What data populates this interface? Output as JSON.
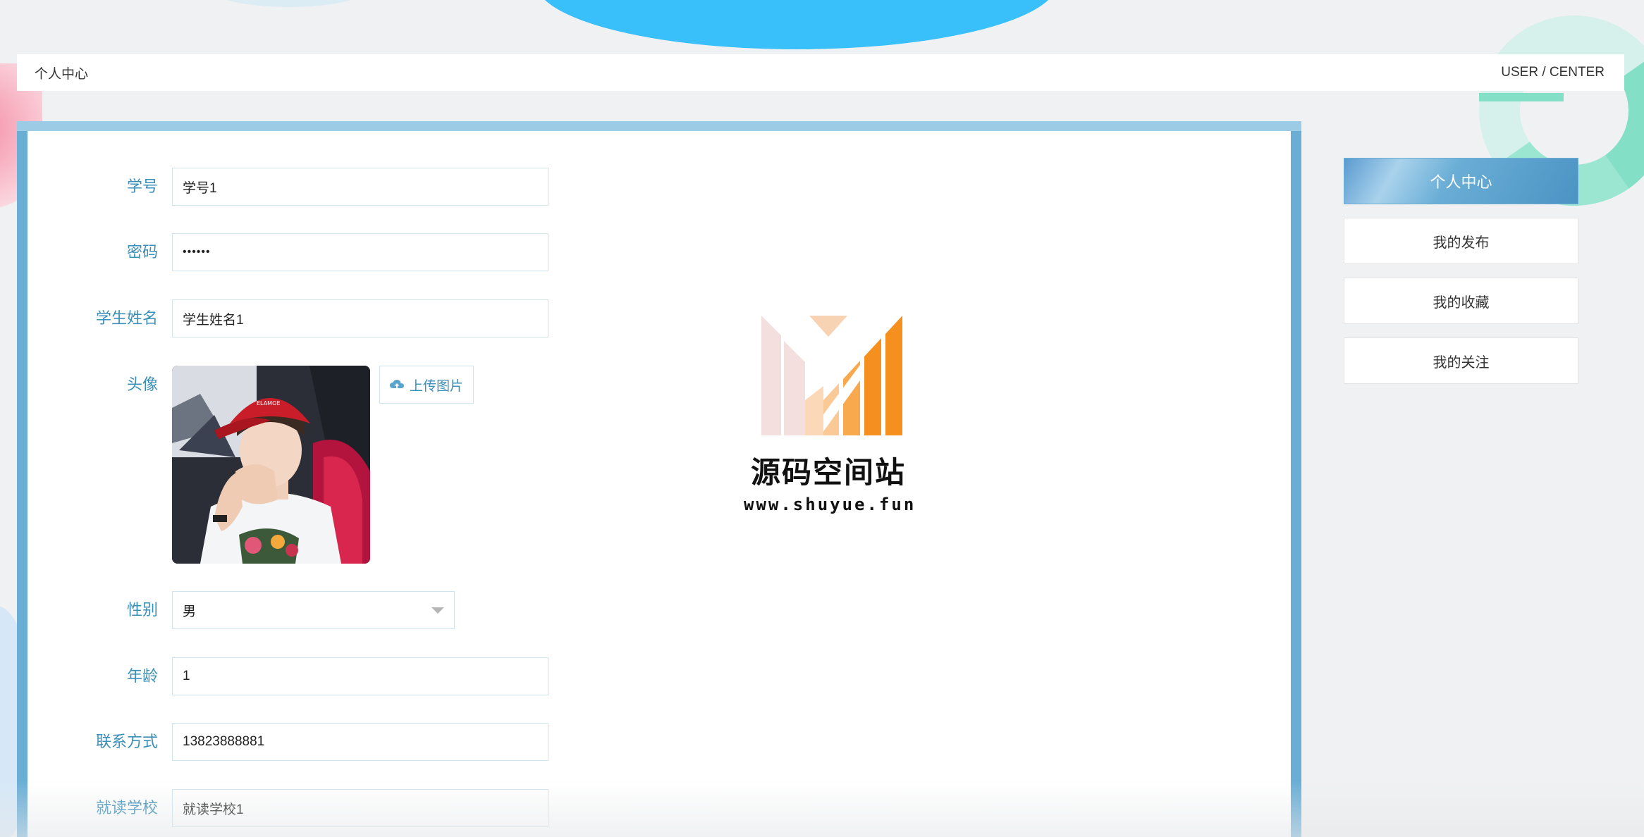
{
  "header": {
    "title": "个人中心",
    "breadcrumb": "USER / CENTER"
  },
  "form": {
    "student_id": {
      "label": "学号",
      "value": "学号1"
    },
    "password": {
      "label": "密码",
      "value": "••••••"
    },
    "student_name": {
      "label": "学生姓名",
      "value": "学生姓名1"
    },
    "avatar": {
      "label": "头像",
      "upload_label": "上传图片"
    },
    "gender": {
      "label": "性别",
      "value": "男"
    },
    "age": {
      "label": "年龄",
      "value": "1"
    },
    "contact": {
      "label": "联系方式",
      "value": "13823888881"
    },
    "school": {
      "label": "就读学校",
      "value": "就读学校1"
    }
  },
  "watermark": {
    "title": "源码空间站",
    "url": "www.shuyue.fun"
  },
  "side_nav": {
    "items": [
      {
        "label": "个人中心",
        "active": true
      },
      {
        "label": "我的发布"
      },
      {
        "label": "我的收藏"
      },
      {
        "label": "我的关注"
      }
    ]
  },
  "colors": {
    "accent": "#3a8fb8",
    "card_border": "#6aaed6",
    "top_wave": "#39c0fb",
    "logo_orange": "#f5901e"
  },
  "icons": {
    "upload": "cloud-upload-icon",
    "select": "chevron-down-icon"
  }
}
